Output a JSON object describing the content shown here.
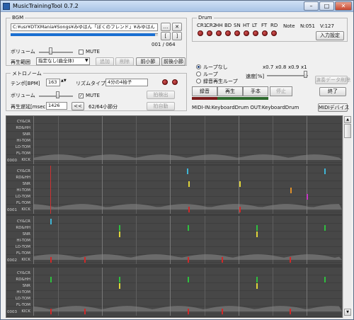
{
  "app": {
    "title": "MusicTrainingTool 0.7.2"
  },
  "bgm": {
    "group_label": "BGM",
    "file_path": "C:¥usr¥DTXMania¥Songs¥みゆはん「ぼくのフレンド」¥みゆはん「ぼくのフレン",
    "seek_progress": 0.98,
    "position_text": "001 / 064",
    "volume_label": "ボリューム",
    "mute_label": "MUTE",
    "section_label": "再生範囲",
    "section_value": "指定なし(曲全体)",
    "add_label": "追加",
    "delete_label": "削除",
    "prev_bar_label": "前小節",
    "next_bar_label": "前後小節"
  },
  "metronome": {
    "group_label": "メトロノーム",
    "tempo_label": "テンポ[BPM]",
    "tempo_value": "163",
    "rhythm_label": "リズムタイプ",
    "rhythm_value": "4分の4拍子",
    "volume_label": "ボリューム",
    "mute_label": "MUTE",
    "mute_checked": true,
    "delay_label": "再生遅延[msec]",
    "delay_value": "1426",
    "rewind_label": "<<",
    "bar_position": "62/64小節分",
    "tap_label": "拍検出",
    "sync_label": "拍自動"
  },
  "drum": {
    "group_label": "Drum",
    "pads": [
      "CR1",
      "CR2",
      "HH",
      "BD",
      "SN",
      "HT",
      "LT",
      "FT",
      "RD"
    ],
    "note_label": "Note",
    "note_value": "N:051",
    "velocity_value": "V:127",
    "input_settings_label": "入力設定"
  },
  "playback": {
    "loop_off_label": "ループなし",
    "loop_label": "ループ",
    "practice_loop_label": "録音再生ループ",
    "loop_selected": 0,
    "speeds": [
      "x0.7",
      "x0.8",
      "x0.9",
      "x1"
    ],
    "speed_label": "速度[%]",
    "record_label": "録音",
    "play_label": "再生",
    "sample_label": "手本",
    "stop_label": "停止",
    "delete_perf_label": "演奏データ削除",
    "exit_label": "終了",
    "midi_status": "MIDI-IN:KeyboardDrum OUT:KeyboardDrum",
    "midi_device_label": "MIDIデバイス"
  },
  "score": {
    "lanes": [
      "CY&CR",
      "RD&HH",
      "SNR",
      "HI-TOM",
      "LO-TOM",
      "FL-TOM",
      "KICK"
    ],
    "bars": [
      {
        "number": "0000",
        "active": false
      },
      {
        "number": "0001",
        "active": true
      },
      {
        "number": "0002",
        "active": false
      },
      {
        "number": "0003",
        "active": false
      }
    ]
  },
  "colors": {
    "accent": "#1b6fd1",
    "active_bar": "#b31d24",
    "note_cy": "#3fb6d6",
    "note_rd": "#2fbf3f",
    "note_snr": "#e0d43a",
    "note_hitom": "#e0902a",
    "note_lotom": "#c637c6",
    "note_kick": "#d02828"
  }
}
